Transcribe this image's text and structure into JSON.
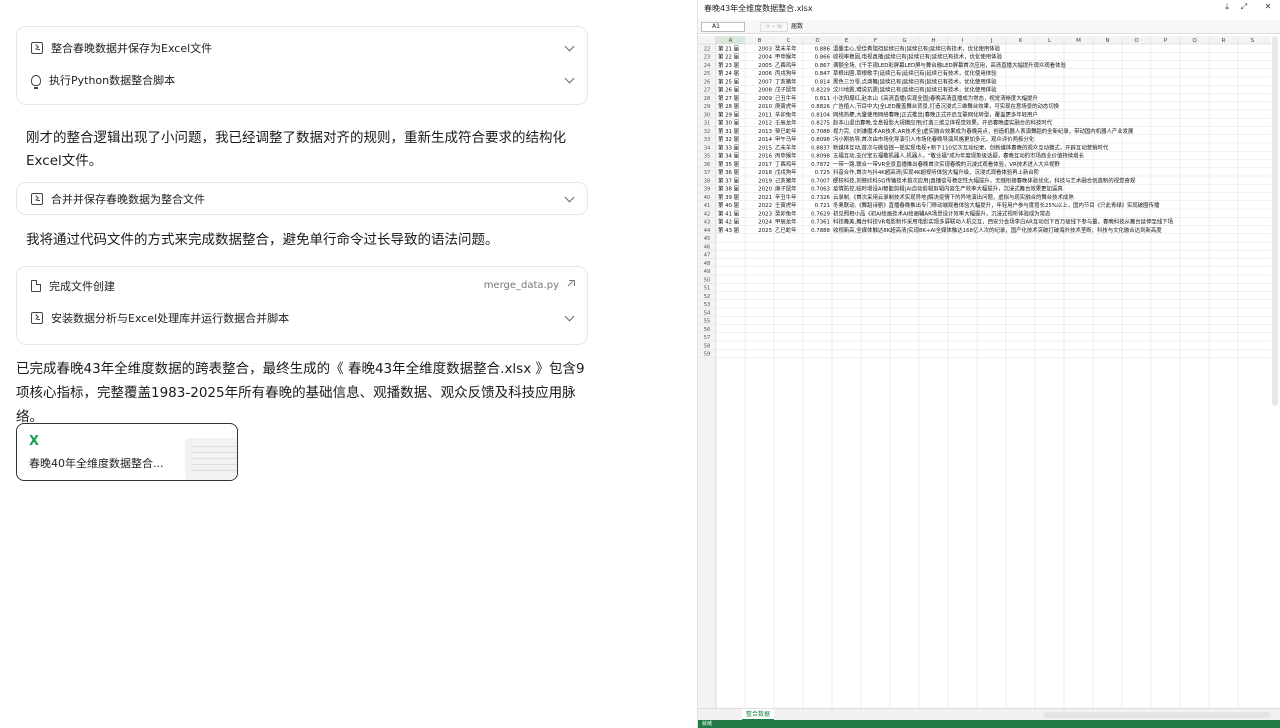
{
  "chat": {
    "steps_group1": [
      {
        "label": "整合春晚数据并保存为Excel文件",
        "icon": "terminal-icon"
      },
      {
        "label": "执行Python数据整合脚本",
        "icon": "lightbulb-icon"
      }
    ],
    "message1": "刚才的整合逻辑出现了小问题，我已经调整了数据对齐的规则，重新生成符合要求的结构化Excel文件。",
    "step_single": {
      "label": "合并并保存春晚数据为整合文件",
      "icon": "terminal-icon"
    },
    "message2": "我将通过代码文件的方式来完成数据整合，避免单行命令过长导致的语法问题。",
    "steps_group2": [
      {
        "label": "完成文件创建",
        "icon": "file-icon",
        "filename": "merge_data.py"
      },
      {
        "label": "安装数据分析与Excel处理库并运行数据合并脚本",
        "icon": "terminal-icon"
      }
    ],
    "summary": "已完成春晚43年全维度数据的跨表整合，最终生成的《 春晚43年全维度数据整合.xlsx 》包含9项核心指标，完整覆盖1983-2025年所有春晚的基础信息、观播数据、观众反馈及科技应用脉络。",
    "attachment": {
      "name": "春晚40年全维度数据整合...",
      "icon": "X"
    }
  },
  "viewer": {
    "title": "春晚43年全维度数据整合.xlsx",
    "cell_ref": "A1",
    "formula_value": "届数",
    "sheet_tab": "整合数据",
    "columns": [
      "A",
      "B",
      "C",
      "D",
      "E",
      "F",
      "G",
      "H",
      "I",
      "J",
      "K",
      "L",
      "M",
      "N",
      "O",
      "P",
      "Q",
      "R",
      "S"
    ],
    "rows": [
      {
        "r": 22,
        "a": "第 21 届",
        "b": "2003",
        "c": "癸未羊年",
        "d": "0.886",
        "e": "温馨走心,受佳肴阻挡延续已有|延续已有|延续已有技术，优化使用体验"
      },
      {
        "r": 23,
        "a": "第 22 届",
        "b": "2004",
        "c": "甲申猴年",
        "d": "0.866",
        "e": "收视率稳固,电视直播|延续已有|延续已有|延续已有技术，优化使用体验"
      },
      {
        "r": 24,
        "a": "第 23 届",
        "b": "2005",
        "c": "乙酉鸡年",
        "d": "0.867",
        "e": "满额全场,《千手观LED彩屏幕LED屏与舞台融LED屏幕首次应用，高清直播大幅提升观众观看体验"
      },
      {
        "r": 25,
        "a": "第 24 届",
        "b": "2006",
        "c": "丙戌狗年",
        "d": "0.847",
        "e": "草根出圈,草根歌手|延续已有|延续已有|延续已有技术，优化使用体验"
      },
      {
        "r": 26,
        "a": "第 25 届",
        "b": "2007",
        "c": "丁亥猪年",
        "d": "0.814",
        "e": "黑色三分零,点滴舞|延续已有|延续已有|延续已有技术，优化使用体验"
      },
      {
        "r": 27,
        "a": "第 26 届",
        "b": "2008",
        "c": "戊子鼠年",
        "d": "0.8229",
        "e": "汶川地震,难说抗震|延续已有|延续已有|延续已有技术，优化使用体验"
      },
      {
        "r": 28,
        "a": "第 27 届",
        "b": "2009",
        "c": "己丑牛年",
        "d": "0.811",
        "e": "小沈阳爆红,赵本山《高清直播|实现全国|春晚高清直播成为常态，视觉清晰度大幅提升"
      },
      {
        "r": 29,
        "a": "第 28 届",
        "b": "2010",
        "c": "庚寅虎年",
        "d": "0.8826",
        "e": "广告植入,节目中大|全LED覆盖舞台背景,打造沉浸式三维舞台效果，可实现在意场景的动态切换"
      },
      {
        "r": 30,
        "a": "第 29 届",
        "b": "2011",
        "c": "辛卯兔年",
        "d": "0.8104",
        "e": "网络热梗,大量使用网络春晚|正式推出|春晚正式开启互联网化转型，覆盖更多年轻用户"
      },
      {
        "r": 31,
        "a": "第 30 届",
        "b": "2012",
        "c": "壬辰龙年",
        "d": "0.8275",
        "e": "赵本山退出春晚,全息投影大规模应用|打造三维立体视觉效果，开启春晚虚实融合的科技时代"
      },
      {
        "r": 32,
        "a": "第 31 届",
        "b": "2013",
        "c": "癸巳蛇年",
        "d": "0.7088",
        "e": "视力完,《刘谦魔术AR技术,AR技术全|虚实融合效果成为春晚亮点，创造机器人表演舞蹈的全新纪录，带动国内机器人产业发展"
      },
      {
        "r": 33,
        "a": "第 32 届",
        "b": "2014",
        "c": "甲午马年",
        "d": "0.8098",
        "e": "冯小刚执导,首次由市场化导演引入市场化春晚导演风格更加多元，观众评价两极分化"
      },
      {
        "r": 34,
        "a": "第 33 届",
        "b": "2015",
        "c": "乙未羊年",
        "d": "0.8837",
        "e": "新媒体互动,首次与微信摇一摇实现电视+新下110亿次互动纪录，创新媒体春晚的观众互动模式，开辟互动营销时代"
      },
      {
        "r": 35,
        "a": "第 34 届",
        "b": "2016",
        "c": "丙申猴年",
        "d": "0.8098",
        "e": "五福互动,支付宝五福敬机器人,机器人，\"敬业福\"成为年度现象级话题，春晚互动的市场商业价值持续增长"
      },
      {
        "r": 36,
        "a": "第 35 届",
        "b": "2017",
        "c": "丁酉鸡年",
        "d": "0.7872",
        "e": "一带一路,联合一带VR全景直播推出春晚首次实现春晚的沉浸式观看体验，VR技术进入大众视野"
      },
      {
        "r": 37,
        "a": "第 36 届",
        "b": "2018",
        "c": "戊戌狗年",
        "d": "0.725",
        "e": "抖音合作,首次与抖4K超高清|实现4K超视听体验大幅升级，沉浸式观看体验再上新台阶"
      },
      {
        "r": 38,
        "a": "第 37 届",
        "b": "2019",
        "c": "己亥猪年",
        "d": "0.7007",
        "e": "硬核科技,刘慈欣科5G传输技术首次应用|直播信号稳定性大幅提升，无缝衔接春晚体验优化，科技与艺术融合创造新的视觉奇观"
      },
      {
        "r": 39,
        "a": "第 38 届",
        "b": "2020",
        "c": "庚子鼠年",
        "d": "0.7063",
        "e": "疫情防控,临时增设AI智能剪辑|AI自动剪辑剪辑内容生产效率大幅提升，沉浸式舞台效果更加逼真"
      },
      {
        "r": 40,
        "a": "第 39 届",
        "b": "2021",
        "c": "辛丑牛年",
        "d": "0.7326",
        "e": "云录制,《首次采用云录制技术实现异地|解决疫情下的异地演出问题，虚拟与现实融合的舞台技术成熟"
      },
      {
        "r": 41,
        "a": "第 40 届",
        "b": "2022",
        "c": "壬寅虎年",
        "d": "0.721",
        "e": "冬奥联动,《舞蹈诗剧》直播春晚推出专门移动端观看体验大幅提升，年轻用户参与度增长25%以上，国内节目《只此青绿》实现破圈传播"
      },
      {
        "r": 42,
        "a": "第 41 届",
        "b": "2023",
        "c": "癸卯兔年",
        "d": "0.7629",
        "e": "初见照相小品《初AI绘画技术AI绘画辅AR场景设计效率大幅提升，沉浸式视听体验成为常态"
      },
      {
        "r": 43,
        "a": "第 42 届",
        "b": "2024",
        "c": "甲辰龙年",
        "d": "0.7361",
        "e": "科技舞美,舞台科技VR电影制作采用电影实现多屏联动人机交互，西安分会场李白AR互动创下百万级线下参与量，春晚科技从舞台延伸至线下场"
      },
      {
        "r": 44,
        "a": "第 43 届",
        "b": "2025",
        "c": "乙巳蛇年",
        "d": "0.7888",
        "e": "收视新高,全媒体触达8K超高清|实现8K+AI全媒体触达168亿人次的纪录，国产化技术突破打破海外技术垄断，科技与文化融合达到新高度"
      }
    ],
    "empty_rows": [
      45,
      46,
      47,
      48,
      49,
      50,
      51,
      52,
      53,
      54,
      55,
      56,
      57,
      58,
      59
    ],
    "status_left": "就绪"
  }
}
